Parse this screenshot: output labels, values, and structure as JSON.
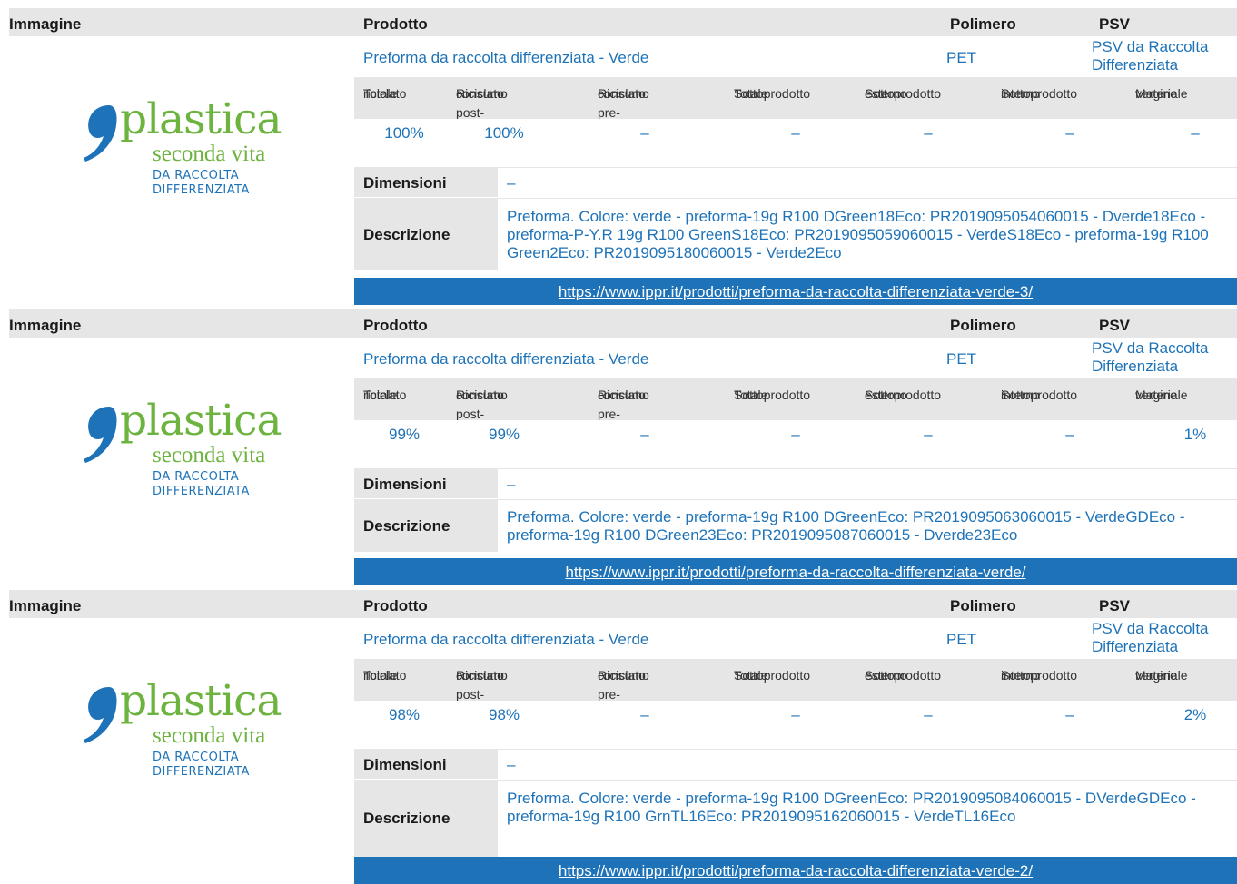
{
  "headers": {
    "immagine": "Immagine",
    "prodotto": "Prodotto",
    "polimero": "Polimero",
    "psv": "PSV"
  },
  "logo": {
    "line1": "plastica",
    "line2": "seconda vita",
    "line3": "DA RACCOLTA",
    "line4": "DIFFERENZIATA",
    "colors": {
      "green": "#6db33f",
      "blue": "#1e73b8"
    }
  },
  "labels": {
    "totale_riciclato": [
      "Totale",
      "riciclato"
    ],
    "riciclato_post": [
      "Riciclato post-",
      "consumo"
    ],
    "riciclato_pre": [
      "Riciclato pre-",
      "consumo"
    ],
    "totale_sottoprodotto": [
      "Totale",
      "Sottoprodotto"
    ],
    "sottoprodotto_esterno": [
      "Sottoprodotto",
      "esterno"
    ],
    "sottoprodotto_interno": [
      "Sottoprodotto",
      "interno"
    ],
    "materiale_vergine": [
      "Materiale",
      "vergine"
    ],
    "dimensioni": "Dimensioni",
    "descrizione": "Descrizione"
  },
  "products": [
    {
      "name": "Preforma da raccolta differenziata - Verde",
      "polimero": "PET",
      "psv": "PSV da Raccolta Differenziata",
      "values": [
        "100%",
        "100%",
        "–",
        "–",
        "–",
        "–",
        "–"
      ],
      "dimensioni": "–",
      "descrizione": "Preforma. Colore: verde - preforma-19g R100 DGreen18Eco: PR2019095054060015 - Dverde18Eco - preforma-P-Y.R 19g R100 GreenS18Eco: PR2019095059060015 - VerdeS18Eco - preforma-19g R100 Green2Eco: PR2019095180060015 - Verde2Eco",
      "url": "https://www.ippr.it/prodotti/preforma-da-raccolta-differenziata-verde-3/"
    },
    {
      "name": "Preforma da raccolta differenziata - Verde",
      "polimero": "PET",
      "psv": "PSV da Raccolta Differenziata",
      "values": [
        "99%",
        "99%",
        "–",
        "–",
        "–",
        "–",
        "1%"
      ],
      "dimensioni": "–",
      "descrizione": "Preforma. Colore: verde - preforma-19g R100 DGreenEco: PR2019095063060015 - VerdeGDEco - preforma-19g R100 DGreen23Eco: PR2019095087060015 - Dverde23Eco",
      "url": "https://www.ippr.it/prodotti/preforma-da-raccolta-differenziata-verde/"
    },
    {
      "name": "Preforma da raccolta differenziata - Verde",
      "polimero": "PET",
      "psv": "PSV da Raccolta Differenziata",
      "values": [
        "98%",
        "98%",
        "–",
        "–",
        "–",
        "–",
        "2%"
      ],
      "dimensioni": "–",
      "descrizione": "Preforma. Colore: verde - preforma-19g R100 DGreenEco: PR2019095084060015 - DVerdeGDEco - preforma-19g R100 GrnTL16Eco: PR2019095162060015 - VerdeTL16Eco",
      "url": "https://www.ippr.it/prodotti/preforma-da-raccolta-differenziata-verde-2/"
    }
  ]
}
